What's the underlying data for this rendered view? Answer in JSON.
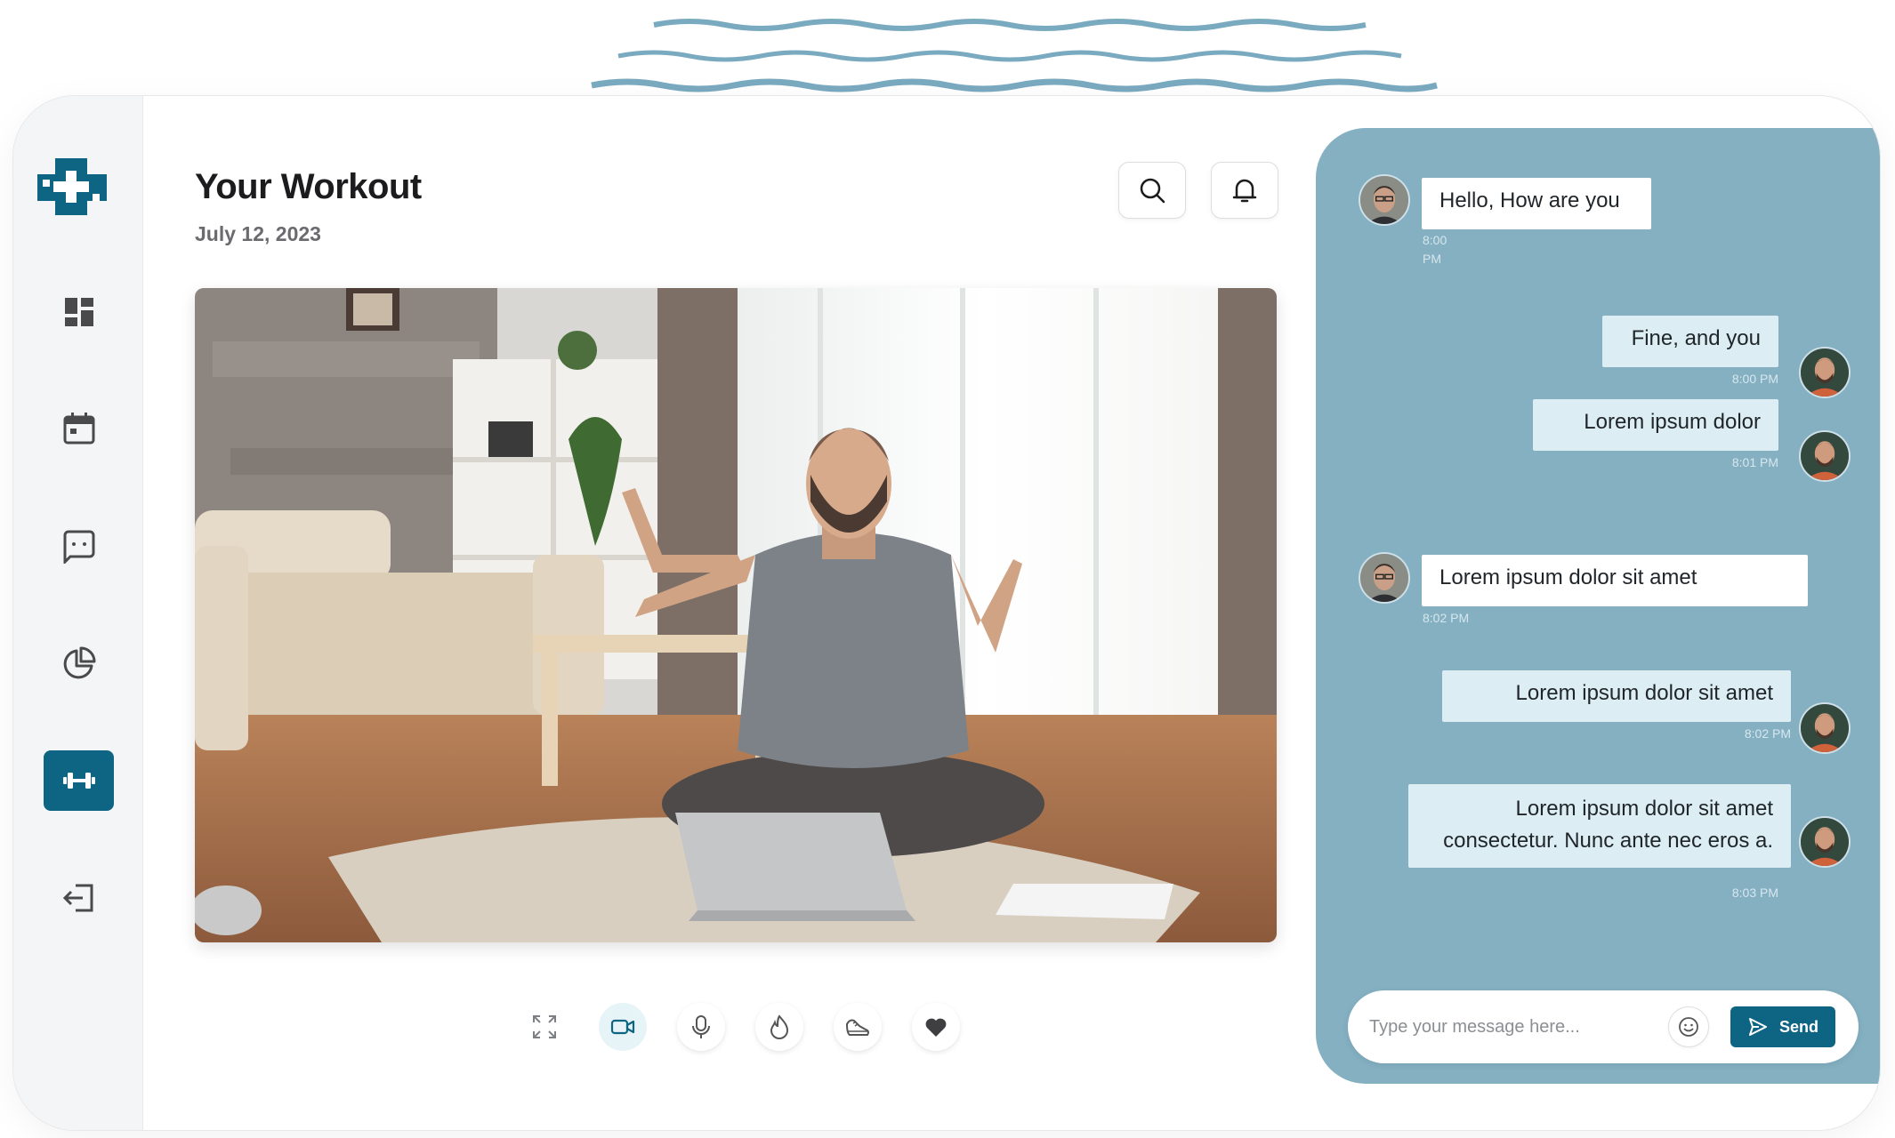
{
  "theme": {
    "accent": "#0e6483",
    "chat_panel": "#84b0c2",
    "wave": "#7aaac0"
  },
  "sidebar": {
    "logo": "medical-cross-logo",
    "items": [
      {
        "icon": "dashboard-icon",
        "active": false
      },
      {
        "icon": "calendar-icon",
        "active": false
      },
      {
        "icon": "chat-icon",
        "active": false
      },
      {
        "icon": "pie-chart-icon",
        "active": false
      },
      {
        "icon": "dumbbell-icon",
        "active": true
      },
      {
        "icon": "logout-icon",
        "active": false
      }
    ]
  },
  "header": {
    "title": "Your Workout",
    "date": "July 12, 2023",
    "actions": [
      "search-icon",
      "bell-icon"
    ]
  },
  "video": {
    "content": "video-feed"
  },
  "controls": [
    {
      "icon": "fullscreen-icon",
      "active": false
    },
    {
      "icon": "video-camera-icon",
      "active": true
    },
    {
      "icon": "microphone-icon",
      "active": false
    },
    {
      "icon": "flame-icon",
      "active": false
    },
    {
      "icon": "sneaker-icon",
      "active": false
    },
    {
      "icon": "heart-icon",
      "active": false
    }
  ],
  "chat": {
    "messages": [
      {
        "direction": "in",
        "text": "Hello, How are you",
        "time_line1": "8:00",
        "time_line2": "PM"
      },
      {
        "direction": "out",
        "text": "Fine, and you",
        "time": "8:00 PM"
      },
      {
        "direction": "out",
        "text": "Lorem ipsum dolor",
        "time": "8:01 PM"
      },
      {
        "direction": "in",
        "text": "Lorem ipsum dolor sit amet",
        "time": "8:02 PM"
      },
      {
        "direction": "out",
        "text": "Lorem ipsum dolor sit amet",
        "time": "8:02 PM"
      },
      {
        "direction": "out",
        "text_line1": "Lorem ipsum dolor sit amet",
        "text_line2": "consectetur. Nunc ante nec eros a.",
        "time": "8:03 PM"
      }
    ],
    "input": {
      "placeholder": "Type your message here...",
      "value": "",
      "emoji_icon": "smiley-icon",
      "send_icon": "paper-plane-icon",
      "send_label": "Send"
    }
  }
}
